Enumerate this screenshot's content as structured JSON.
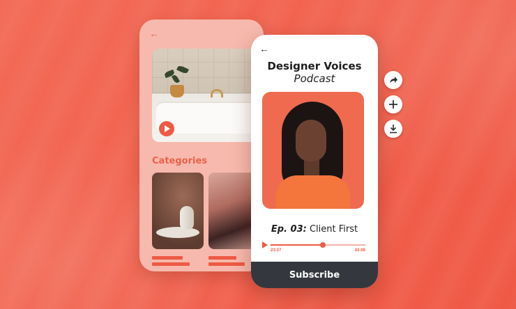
{
  "colors": {
    "background": "#f2624c",
    "accent": "#ee5a44",
    "back_phone": "#f7b9ad",
    "subscribe_bg": "#34373d"
  },
  "back_screen": {
    "back_icon": "arrow-left-icon",
    "hero_play_icon": "play-icon",
    "categories_title": "Categories",
    "more_icon": "more-dots-icon",
    "add_icon": "plus-icon"
  },
  "podcast": {
    "back_icon": "arrow-left-icon",
    "title": "Designer Voices",
    "subtitle": "Podcast",
    "episode_number": "Ep. 03:",
    "episode_title": "Client First",
    "elapsed": "23:27",
    "duration": "43:00",
    "progress_fraction": 0.55,
    "subscribe_label": "Subscribe"
  },
  "actions": [
    {
      "icon": "share-icon"
    },
    {
      "icon": "plus-icon"
    },
    {
      "icon": "download-icon"
    }
  ]
}
